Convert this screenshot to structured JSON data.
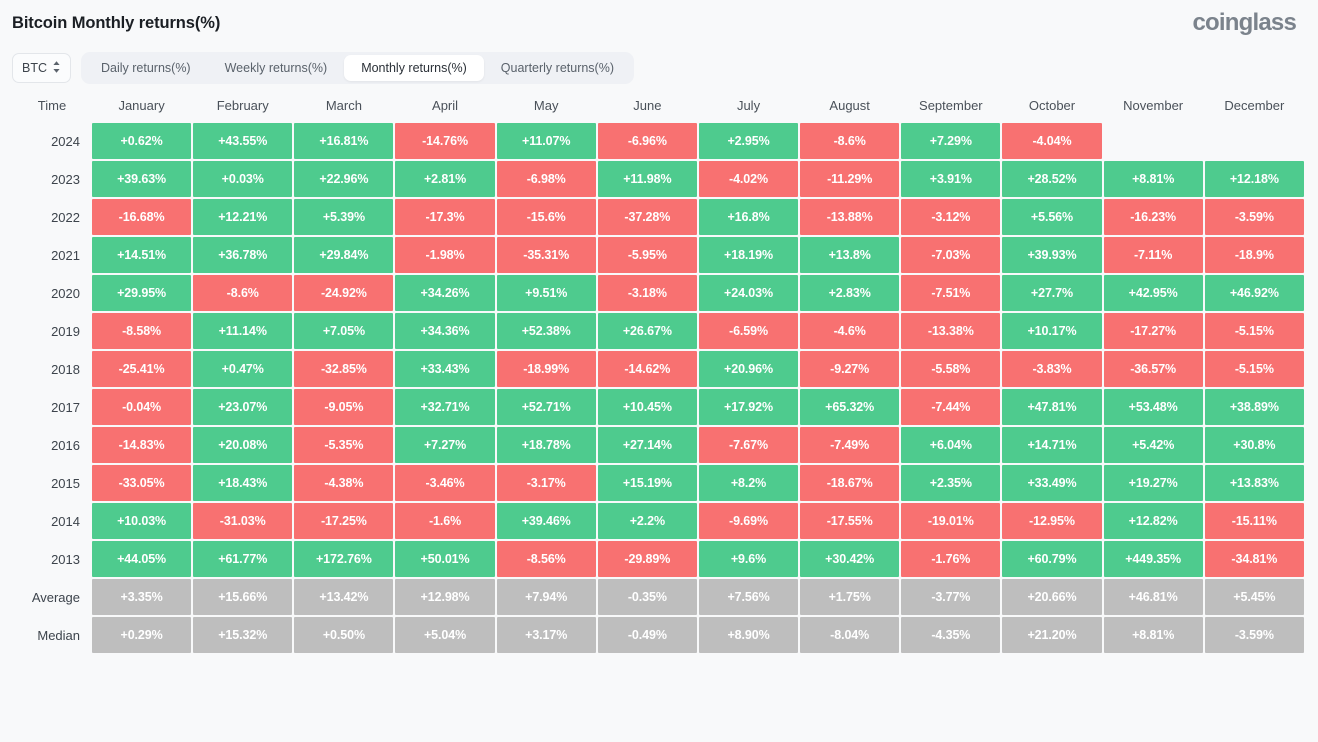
{
  "header": {
    "title": "Bitcoin Monthly returns(%)",
    "brand": "coinglass"
  },
  "controls": {
    "coin_selector": {
      "value": "BTC",
      "icon": "chevron-up-down-icon"
    },
    "tabs": [
      {
        "label": "Daily returns(%)",
        "active": false
      },
      {
        "label": "Weekly returns(%)",
        "active": false
      },
      {
        "label": "Monthly returns(%)",
        "active": true
      },
      {
        "label": "Quarterly returns(%)",
        "active": false
      }
    ]
  },
  "colors": {
    "positive": "#4ecb8e",
    "negative": "#f87171",
    "neutral": "#bebebe",
    "page_background": "#f8f9fa",
    "brand_gray": "#7b838c"
  },
  "chart_data": {
    "type": "heatmap",
    "title": "Bitcoin Monthly returns(%)",
    "xlabel": "",
    "ylabel": "Time",
    "legend": "Green = positive return, Red = negative return, Gray = summary statistic",
    "columns": [
      "Time",
      "January",
      "February",
      "March",
      "April",
      "May",
      "June",
      "July",
      "August",
      "September",
      "October",
      "November",
      "December"
    ],
    "rows": [
      {
        "label": "2024",
        "kind": "year",
        "values": [
          "+0.62%",
          "+43.55%",
          "+16.81%",
          "-14.76%",
          "+11.07%",
          "-6.96%",
          "+2.95%",
          "-8.6%",
          "+7.29%",
          "-4.04%",
          "",
          ""
        ]
      },
      {
        "label": "2023",
        "kind": "year",
        "values": [
          "+39.63%",
          "+0.03%",
          "+22.96%",
          "+2.81%",
          "-6.98%",
          "+11.98%",
          "-4.02%",
          "-11.29%",
          "+3.91%",
          "+28.52%",
          "+8.81%",
          "+12.18%"
        ]
      },
      {
        "label": "2022",
        "kind": "year",
        "values": [
          "-16.68%",
          "+12.21%",
          "+5.39%",
          "-17.3%",
          "-15.6%",
          "-37.28%",
          "+16.8%",
          "-13.88%",
          "-3.12%",
          "+5.56%",
          "-16.23%",
          "-3.59%"
        ]
      },
      {
        "label": "2021",
        "kind": "year",
        "values": [
          "+14.51%",
          "+36.78%",
          "+29.84%",
          "-1.98%",
          "-35.31%",
          "-5.95%",
          "+18.19%",
          "+13.8%",
          "-7.03%",
          "+39.93%",
          "-7.11%",
          "-18.9%"
        ]
      },
      {
        "label": "2020",
        "kind": "year",
        "values": [
          "+29.95%",
          "-8.6%",
          "-24.92%",
          "+34.26%",
          "+9.51%",
          "-3.18%",
          "+24.03%",
          "+2.83%",
          "-7.51%",
          "+27.7%",
          "+42.95%",
          "+46.92%"
        ]
      },
      {
        "label": "2019",
        "kind": "year",
        "values": [
          "-8.58%",
          "+11.14%",
          "+7.05%",
          "+34.36%",
          "+52.38%",
          "+26.67%",
          "-6.59%",
          "-4.6%",
          "-13.38%",
          "+10.17%",
          "-17.27%",
          "-5.15%"
        ]
      },
      {
        "label": "2018",
        "kind": "year",
        "values": [
          "-25.41%",
          "+0.47%",
          "-32.85%",
          "+33.43%",
          "-18.99%",
          "-14.62%",
          "+20.96%",
          "-9.27%",
          "-5.58%",
          "-3.83%",
          "-36.57%",
          "-5.15%"
        ]
      },
      {
        "label": "2017",
        "kind": "year",
        "values": [
          "-0.04%",
          "+23.07%",
          "-9.05%",
          "+32.71%",
          "+52.71%",
          "+10.45%",
          "+17.92%",
          "+65.32%",
          "-7.44%",
          "+47.81%",
          "+53.48%",
          "+38.89%"
        ]
      },
      {
        "label": "2016",
        "kind": "year",
        "values": [
          "-14.83%",
          "+20.08%",
          "-5.35%",
          "+7.27%",
          "+18.78%",
          "+27.14%",
          "-7.67%",
          "-7.49%",
          "+6.04%",
          "+14.71%",
          "+5.42%",
          "+30.8%"
        ]
      },
      {
        "label": "2015",
        "kind": "year",
        "values": [
          "-33.05%",
          "+18.43%",
          "-4.38%",
          "-3.46%",
          "-3.17%",
          "+15.19%",
          "+8.2%",
          "-18.67%",
          "+2.35%",
          "+33.49%",
          "+19.27%",
          "+13.83%"
        ]
      },
      {
        "label": "2014",
        "kind": "year",
        "values": [
          "+10.03%",
          "-31.03%",
          "-17.25%",
          "-1.6%",
          "+39.46%",
          "+2.2%",
          "-9.69%",
          "-17.55%",
          "-19.01%",
          "-12.95%",
          "+12.82%",
          "-15.11%"
        ]
      },
      {
        "label": "2013",
        "kind": "year",
        "values": [
          "+44.05%",
          "+61.77%",
          "+172.76%",
          "+50.01%",
          "-8.56%",
          "-29.89%",
          "+9.6%",
          "+30.42%",
          "-1.76%",
          "+60.79%",
          "+449.35%",
          "-34.81%"
        ]
      },
      {
        "label": "Average",
        "kind": "summary",
        "values": [
          "+3.35%",
          "+15.66%",
          "+13.42%",
          "+12.98%",
          "+7.94%",
          "-0.35%",
          "+7.56%",
          "+1.75%",
          "-3.77%",
          "+20.66%",
          "+46.81%",
          "+5.45%"
        ]
      },
      {
        "label": "Median",
        "kind": "summary",
        "values": [
          "+0.29%",
          "+15.32%",
          "+0.50%",
          "+5.04%",
          "+3.17%",
          "-0.49%",
          "+8.90%",
          "-8.04%",
          "-4.35%",
          "+21.20%",
          "+8.81%",
          "-3.59%"
        ]
      }
    ]
  }
}
